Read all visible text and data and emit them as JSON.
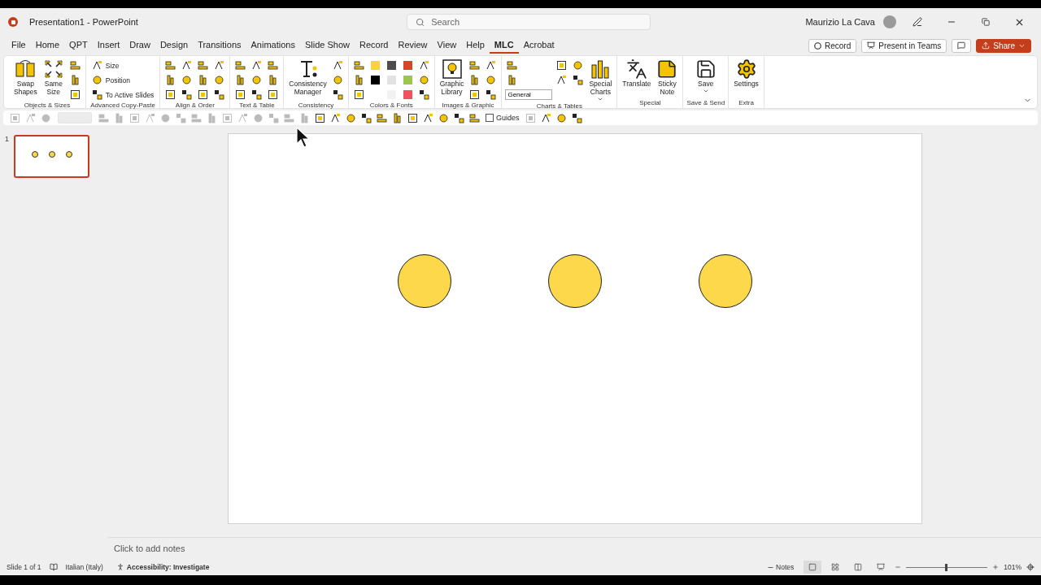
{
  "window": {
    "title": "Presentation1  -  PowerPoint",
    "user": "Maurizio La Cava"
  },
  "search": {
    "placeholder": "Search"
  },
  "menu_tabs": [
    {
      "label": "File",
      "selected": false
    },
    {
      "label": "Home",
      "selected": false
    },
    {
      "label": "QPT",
      "selected": false
    },
    {
      "label": "Insert",
      "selected": false
    },
    {
      "label": "Draw",
      "selected": false
    },
    {
      "label": "Design",
      "selected": false
    },
    {
      "label": "Transitions",
      "selected": false
    },
    {
      "label": "Animations",
      "selected": false
    },
    {
      "label": "Slide Show",
      "selected": false
    },
    {
      "label": "Record",
      "selected": false
    },
    {
      "label": "Review",
      "selected": false
    },
    {
      "label": "View",
      "selected": false
    },
    {
      "label": "Help",
      "selected": false
    },
    {
      "label": "MLC",
      "selected": true
    },
    {
      "label": "Acrobat",
      "selected": false
    }
  ],
  "header_buttons": [
    {
      "kind": "record",
      "label": "Record"
    },
    {
      "kind": "teams",
      "label": "Present in Teams"
    },
    {
      "kind": "comment"
    },
    {
      "kind": "share",
      "label": "Share"
    }
  ],
  "ribbon_groups": [
    {
      "label": "Objects & Sizes",
      "columns": [
        [
          {
            "kind": "large",
            "label": "Swap Shapes"
          }
        ],
        [
          {
            "kind": "large",
            "label": "Same Size"
          }
        ],
        [
          {
            "kind": "icon"
          },
          {
            "kind": "icon"
          },
          {
            "kind": "icon"
          }
        ]
      ]
    },
    {
      "label": "Advanced Copy-Paste",
      "columns": [
        [
          {
            "kind": "small",
            "label": "Size"
          },
          {
            "kind": "small",
            "label": "Position"
          },
          {
            "kind": "small",
            "label": "To Active Slides"
          }
        ]
      ]
    },
    {
      "label": "Align & Order",
      "columns": [
        [
          {
            "kind": "icon"
          },
          {
            "kind": "icon"
          },
          {
            "kind": "icon"
          }
        ],
        [
          {
            "kind": "icon"
          },
          {
            "kind": "icon"
          },
          {
            "kind": "icon"
          }
        ],
        [
          {
            "kind": "icon"
          },
          {
            "kind": "icon"
          },
          {
            "kind": "icon"
          }
        ],
        [
          {
            "kind": "icon"
          },
          {
            "kind": "icon"
          },
          {
            "kind": "icon"
          }
        ]
      ]
    },
    {
      "label": "Text & Table",
      "columns": [
        [
          {
            "kind": "icon"
          },
          {
            "kind": "icon"
          },
          {
            "kind": "icon"
          }
        ],
        [
          {
            "kind": "icon"
          },
          {
            "kind": "icon"
          },
          {
            "kind": "icon"
          }
        ],
        [
          {
            "kind": "icon"
          },
          {
            "kind": "icon"
          },
          {
            "kind": "icon"
          }
        ]
      ]
    },
    {
      "label": "Consistency",
      "columns": [
        [
          {
            "kind": "large",
            "label": "Consistency Manager"
          }
        ],
        [
          {
            "kind": "icon"
          },
          {
            "kind": "icon"
          },
          {
            "kind": "icon"
          }
        ]
      ]
    },
    {
      "label": "Colors & Fonts",
      "columns": [
        [
          {
            "kind": "icon"
          },
          {
            "kind": "icon"
          },
          {
            "kind": "icon"
          }
        ],
        [
          {
            "kind": "swatch",
            "color": "#f9d23c"
          },
          {
            "kind": "swatch",
            "color": "#000000"
          }
        ],
        [
          {
            "kind": "swatch",
            "color": "#4d4d4d"
          },
          {
            "kind": "swatch",
            "color": "#e3e3e3"
          },
          {
            "kind": "swatch",
            "color": "#f2f2f2"
          }
        ],
        [
          {
            "kind": "swatch",
            "color": "#d5452b"
          },
          {
            "kind": "swatch",
            "color": "#9dc64a"
          },
          {
            "kind": "swatch",
            "color": "#f0525f"
          }
        ],
        [
          {
            "kind": "icon"
          },
          {
            "kind": "icon"
          },
          {
            "kind": "icon"
          }
        ]
      ]
    },
    {
      "label": "Images & Graphic",
      "columns": [
        [
          {
            "kind": "large",
            "label": "Graphic Library"
          }
        ],
        [
          {
            "kind": "icon"
          },
          {
            "kind": "icon"
          },
          {
            "kind": "icon"
          }
        ],
        [
          {
            "kind": "icon"
          },
          {
            "kind": "icon"
          },
          {
            "kind": "icon"
          }
        ]
      ]
    },
    {
      "label": "Charts & Tables",
      "columns": [
        [
          {
            "kind": "icon"
          },
          {
            "kind": "icon"
          },
          {
            "kind": "select",
            "value": "General"
          }
        ],
        [
          {
            "kind": "icon"
          },
          {
            "kind": "icon"
          }
        ],
        [
          {
            "kind": "icon"
          },
          {
            "kind": "icon"
          }
        ],
        [
          {
            "kind": "large",
            "label": "Special Charts",
            "caret": true
          }
        ]
      ]
    },
    {
      "label": "Special",
      "columns": [
        [
          {
            "kind": "large",
            "label": "Translate"
          }
        ],
        [
          {
            "kind": "large",
            "label": "Sticky Note"
          }
        ]
      ]
    },
    {
      "label": "Save & Send",
      "columns": [
        [
          {
            "kind": "large",
            "label": "Save",
            "caret": true
          }
        ]
      ]
    },
    {
      "label": "Extra",
      "columns": [
        [
          {
            "kind": "large",
            "label": "Settings"
          }
        ]
      ]
    }
  ],
  "quick_toolbar": [
    {
      "kind": "icon",
      "disabled": true
    },
    {
      "kind": "icon",
      "disabled": true
    },
    {
      "kind": "icon",
      "disabled": true
    },
    {
      "kind": "select",
      "disabled": true
    },
    {
      "kind": "icon",
      "disabled": true
    },
    {
      "kind": "icon",
      "disabled": true
    },
    {
      "kind": "icon",
      "disabled": true
    },
    {
      "kind": "icon",
      "disabled": true
    },
    {
      "kind": "icon",
      "disabled": true
    },
    {
      "kind": "icon",
      "disabled": true
    },
    {
      "kind": "icon",
      "disabled": true
    },
    {
      "kind": "icon",
      "disabled": true
    },
    {
      "kind": "icon",
      "disabled": true
    },
    {
      "kind": "icon",
      "disabled": true
    },
    {
      "kind": "icon",
      "disabled": true
    },
    {
      "kind": "icon",
      "disabled": true
    },
    {
      "kind": "icon",
      "disabled": true
    },
    {
      "kind": "icon",
      "disabled": true
    },
    {
      "kind": "icon",
      "disabled": false
    },
    {
      "kind": "icon",
      "disabled": false
    },
    {
      "kind": "icon",
      "disabled": false
    },
    {
      "kind": "icon",
      "disabled": false
    },
    {
      "kind": "icon",
      "disabled": false
    },
    {
      "kind": "icon",
      "disabled": false
    },
    {
      "kind": "icon",
      "disabled": false
    },
    {
      "kind": "icon",
      "disabled": false
    },
    {
      "kind": "icon",
      "disabled": false
    },
    {
      "kind": "icon",
      "disabled": false
    },
    {
      "kind": "icon",
      "disabled": false
    },
    {
      "kind": "checkbox",
      "label": "Guides",
      "checked": false
    },
    {
      "kind": "icon",
      "disabled": true
    },
    {
      "kind": "icon",
      "disabled": false
    },
    {
      "kind": "icon",
      "disabled": false
    },
    {
      "kind": "icon",
      "disabled": false
    }
  ],
  "slides": [
    {
      "number": "1",
      "selected": true,
      "shapes": [
        {
          "kind": "circle"
        },
        {
          "kind": "circle"
        },
        {
          "kind": "circle"
        }
      ]
    }
  ],
  "notes": {
    "placeholder": "Click to add notes"
  },
  "status_bar": {
    "slide": "Slide 1 of 1",
    "language": "Italian (Italy)",
    "accessibility": "Accessibility: Investigate",
    "notes_label": "Notes",
    "views": [
      {
        "kind": "normal",
        "selected": true
      },
      {
        "kind": "sorter",
        "selected": false
      },
      {
        "kind": "reading",
        "selected": false
      },
      {
        "kind": "show",
        "selected": false
      }
    ],
    "zoom": {
      "level": 0.48,
      "reading": "101%"
    }
  }
}
